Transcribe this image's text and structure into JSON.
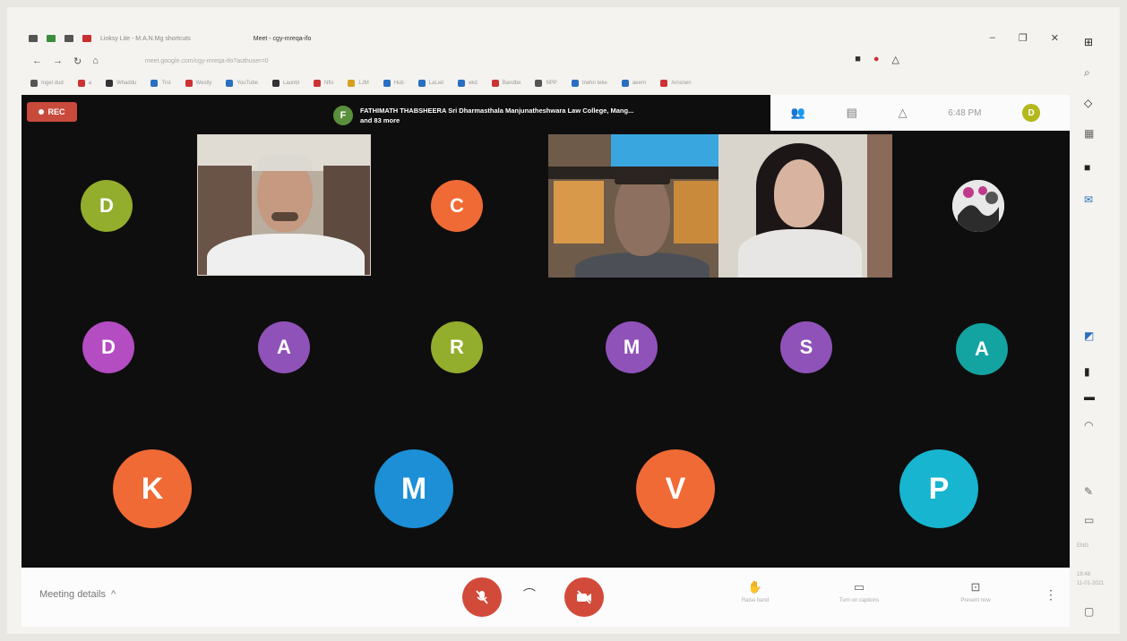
{
  "browser": {
    "tabs": [
      "Linksy Lite - M.A.N.Mg shortcuts",
      "Meet - cgy-mreqa-ifo"
    ],
    "window_controls": [
      "–",
      "❐",
      "✕"
    ],
    "url": "meet.google.com/cgy-mreqa-ifo?authuser=0",
    "bookmarks": [
      "Ingel dud",
      "a",
      "Whaddu",
      "Trst",
      "Westly",
      "YouTube",
      "Launbl",
      "Nfix",
      "LJM",
      "Hub",
      "LaLiet",
      "ekd",
      "Bandbe",
      "NPP",
      "Inehn teke",
      "aeern",
      "Arnsnen"
    ]
  },
  "meeting": {
    "recording_label": "REC",
    "presenter": {
      "initial": "F",
      "line1": "FATHIMATH THABSHEERA Sri Dharmasthala Manjunatheshwara Law College, Mang...",
      "line2": "and 83 more"
    },
    "time": "6:48 PM",
    "self_initial": "D",
    "participants_row1": [
      {
        "initial": "D",
        "color": "#93ad2c"
      },
      {
        "initial": "C",
        "color": "#f06a35"
      }
    ],
    "participants_row2": [
      {
        "initial": "D",
        "color": "#b44cc2"
      },
      {
        "initial": "A",
        "color": "#8f52b8"
      },
      {
        "initial": "R",
        "color": "#93ad2c"
      },
      {
        "initial": "M",
        "color": "#8f52b8"
      },
      {
        "initial": "S",
        "color": "#8f52b8"
      },
      {
        "initial": "A",
        "color": "#13a3a0"
      }
    ],
    "participants_row3": [
      {
        "initial": "K",
        "color": "#f06a35"
      },
      {
        "initial": "M",
        "color": "#1c8fd6"
      },
      {
        "initial": "V",
        "color": "#f06a35"
      },
      {
        "initial": "P",
        "color": "#17b5cf"
      }
    ]
  },
  "controls": {
    "meeting_details": "Meeting details",
    "meeting_details_chevron": "^",
    "raise_hand": "Raise hand",
    "captions": "Turn on captions",
    "present": "Present now"
  },
  "taskbar": {
    "time": "18:48",
    "date": "11-01-2021",
    "lang": "ENG"
  },
  "icons": [
    "record-dot-icon",
    "people-icon",
    "chat-icon",
    "activities-icon",
    "mic-off-icon",
    "hangup-icon",
    "camera-off-icon",
    "raise-hand-icon",
    "captions-icon",
    "present-icon",
    "more-vert-icon"
  ]
}
